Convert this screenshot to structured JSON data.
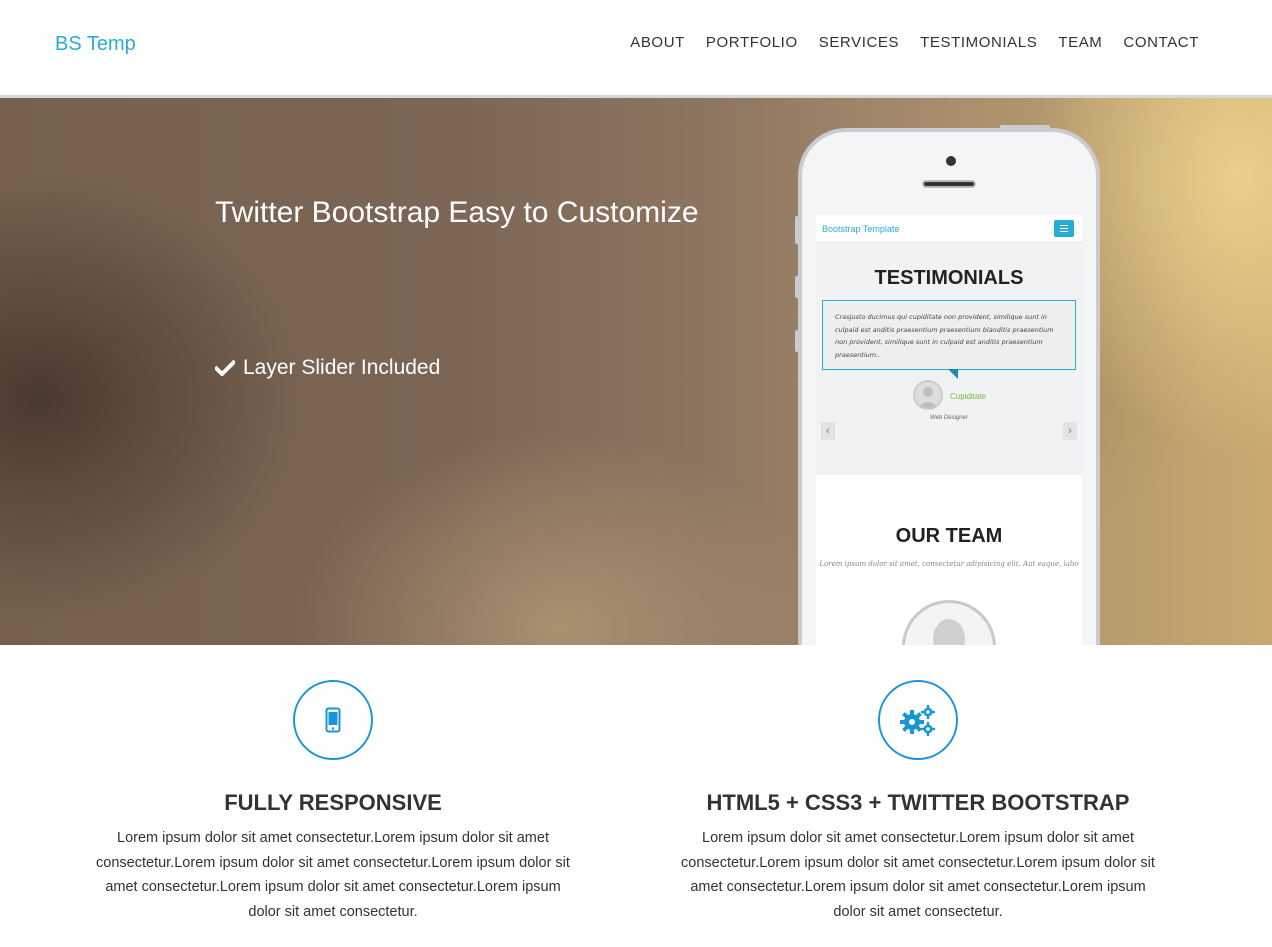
{
  "navbar": {
    "brand": "BS Temp",
    "items": [
      {
        "label": "ABOUT"
      },
      {
        "label": "PORTFOLIO"
      },
      {
        "label": "SERVICES"
      },
      {
        "label": "TESTIMONIALS"
      },
      {
        "label": "TEAM"
      },
      {
        "label": "CONTACT"
      }
    ]
  },
  "hero": {
    "title": "Twitter Bootstrap Easy to Customize",
    "feature": "Layer Slider Included",
    "feature_icon": "checkmark-icon"
  },
  "phone_screen": {
    "brand": "Bootstrap Template",
    "testimonials_heading": "TESTIMONIALS",
    "quote": "Crasjusto ducimus qui cupiditate non provident, similique sunt in culpaid est anditis praesentium praesentium blanditis praesentium non provident, similique sunt in culpaid est anditis praesentium praesentium..",
    "author_name": "Cupiditate",
    "author_role": "Web Designer",
    "team_heading": "OUR TEAM",
    "team_sub": "Lorem ipsum dolor sit amet, consectetur adipisicing elit. Aut eaque, labo"
  },
  "features": [
    {
      "icon": "mobile-phone-icon",
      "title": "FULLY RESPONSIVE",
      "text": "Lorem ipsum dolor sit amet consectetur.Lorem ipsum dolor sit amet consectetur.Lorem ipsum dolor sit amet consectetur.Lorem ipsum dolor sit amet consectetur.Lorem ipsum dolor sit amet consectetur.Lorem ipsum dolor sit amet consectetur."
    },
    {
      "icon": "gears-icon",
      "title": "HTML5 + CSS3 + TWITTER BOOTSTRAP",
      "text": "Lorem ipsum dolor sit amet consectetur.Lorem ipsum dolor sit amet consectetur.Lorem ipsum dolor sit amet consectetur.Lorem ipsum dolor sit amet consectetur.Lorem ipsum dolor sit amet consectetur.Lorem ipsum dolor sit amet consectetur."
    }
  ],
  "colors": {
    "accent": "#29abd6",
    "icon_ring": "#1a96d4",
    "text": "#333333"
  }
}
